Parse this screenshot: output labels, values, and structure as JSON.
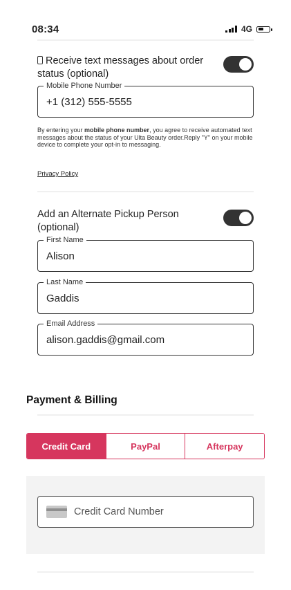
{
  "status_bar": {
    "time": "08:34",
    "network": "4G"
  },
  "sms": {
    "toggle_label": "Receive text messages about order status (optional)",
    "toggle_on": true,
    "phone_label": "Mobile Phone Number",
    "phone_value": "+1 (312) 555-5555",
    "legal_prefix": "By entering your ",
    "legal_bold": "mobile phone number",
    "legal_suffix": ", you agree to receive automated text messages about the status of your Ulta Beauty order.Reply \"Y\" on your mobile device to complete your opt-in to messaging.",
    "privacy_link": "Privacy Policy"
  },
  "alternate_pickup": {
    "toggle_label": "Add an Alternate Pickup Person (optional)",
    "toggle_on": true,
    "first_name_label": "First Name",
    "first_name_value": "Alison",
    "last_name_label": "Last Name",
    "last_name_value": "Gaddis",
    "email_label": "Email Address",
    "email_value": "alison.gaddis@gmail.com"
  },
  "payment": {
    "title": "Payment & Billing",
    "tabs": [
      {
        "label": "Credit Card",
        "active": true
      },
      {
        "label": "PayPal",
        "active": false
      },
      {
        "label": "Afterpay",
        "active": false
      }
    ],
    "card_number_placeholder": "Credit Card Number",
    "accent_color": "#d6365e"
  }
}
